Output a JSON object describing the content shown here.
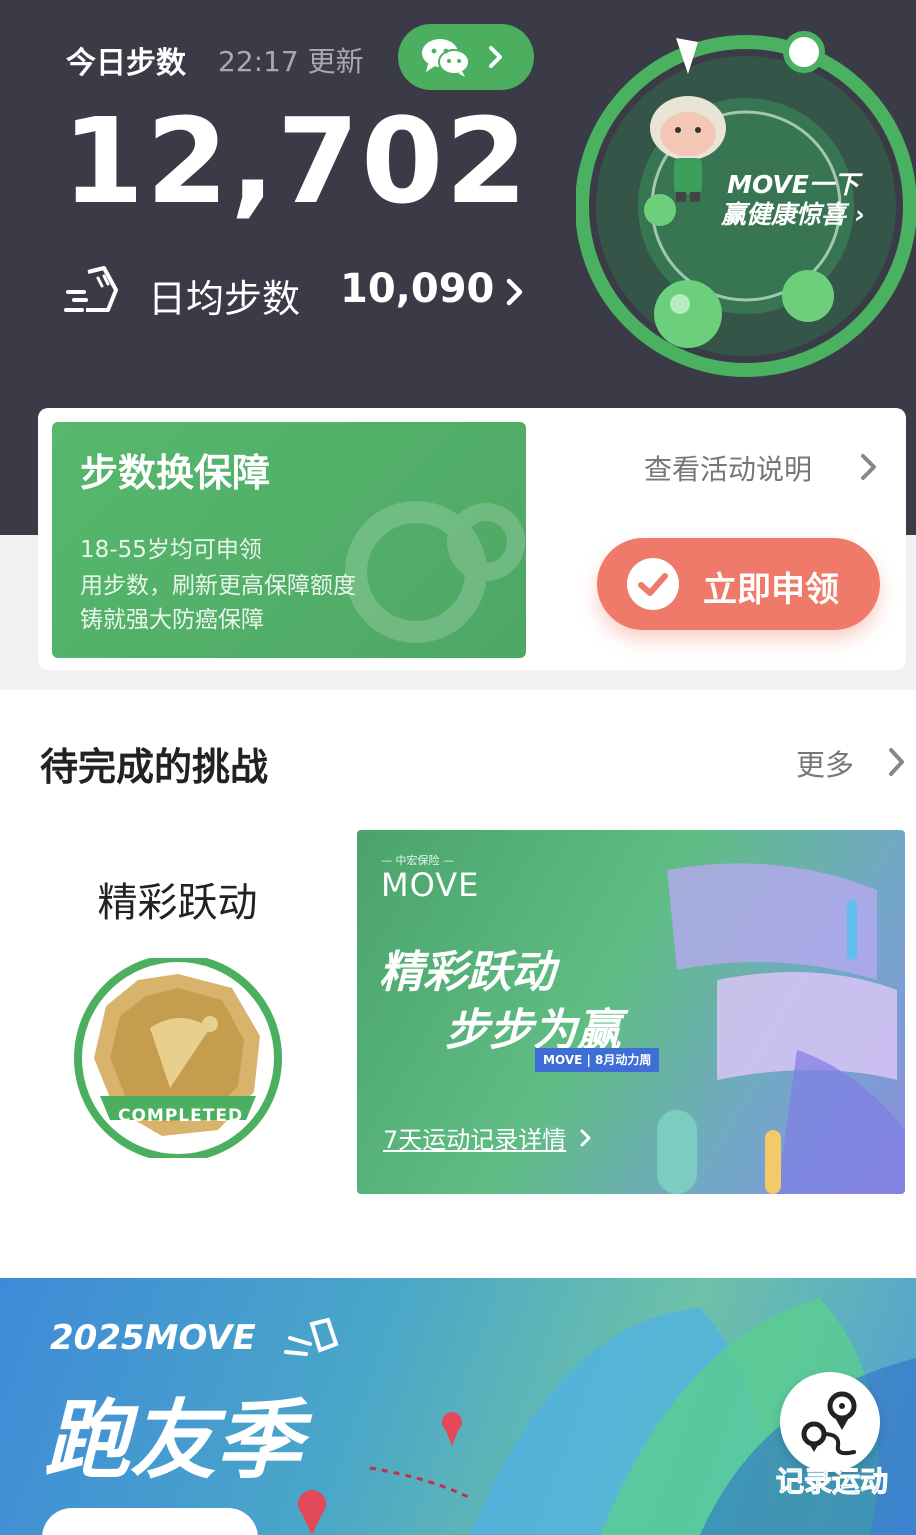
{
  "header": {
    "today_label": "今日步数",
    "update_time": "22:17 更新",
    "steps": "12,702",
    "avg_label": "日均步数",
    "avg_value": "10,090",
    "ring_text_line1": "MOVE一下",
    "ring_text_line2": "赢健康惊喜 ›"
  },
  "promo": {
    "title": "步数换保障",
    "lines": [
      "18-55岁均可申领",
      "用步数，刷新更高保障额度",
      "铸就强大防癌保障"
    ],
    "activity_link": "查看活动说明",
    "claim_button": "立即申领"
  },
  "challenges": {
    "section_title": "待完成的挑战",
    "more": "更多",
    "card": {
      "title": "精彩跃动",
      "medal_text": "COMPLETED"
    },
    "banner": {
      "sub": "— 中宏保险 —",
      "brand": "MOVE",
      "headline1": "精彩跃动",
      "headline2": "步步为赢",
      "tag": "MOVE | 8月动力周",
      "link": "7天运动记录详情"
    }
  },
  "bottom_banner": {
    "year": "2025MOVE",
    "title": "跑友季",
    "record_button": "记录运动"
  },
  "colors": {
    "header_bg": "#3a3b47",
    "brand_green": "#4caf5f",
    "claim_red": "#ef7a6a"
  }
}
